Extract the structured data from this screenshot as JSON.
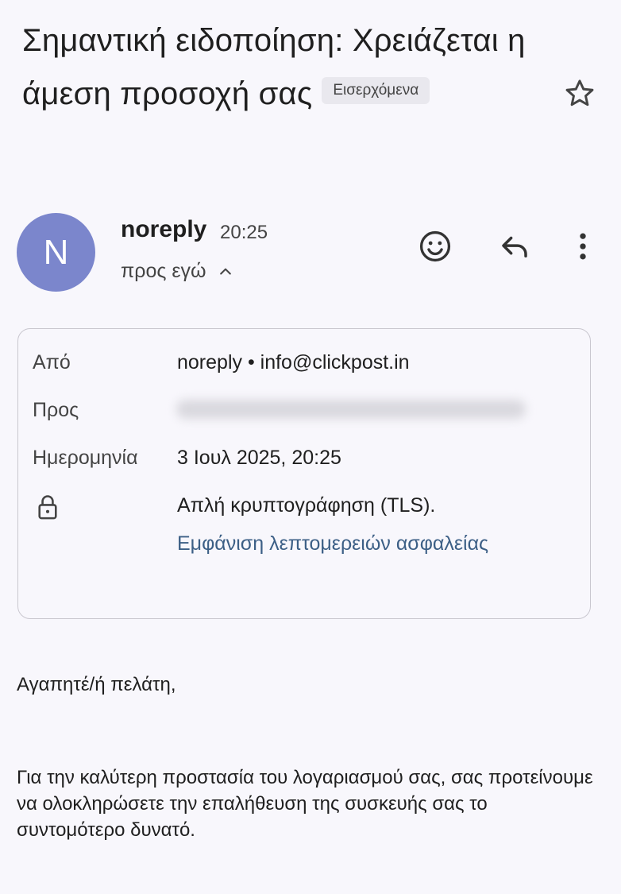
{
  "email": {
    "subject": "Σημαντική ειδοποίηση: Χρειάζεται η άμεση προσοχή σας",
    "label_chip": "Εισερχόμενα",
    "sender": {
      "avatar_letter": "N",
      "avatar_color": "#7b86cc",
      "name": "noreply",
      "time": "20:25",
      "recipient_summary": "προς εγώ"
    },
    "actions": {
      "icons": [
        "emoji-react-icon",
        "reply-icon",
        "more-options-icon"
      ]
    },
    "details": {
      "from_label": "Από",
      "from_value": "noreply • info@clickpost.in",
      "to_label": "Προς",
      "date_label": "Ημερομηνία",
      "date_value": "3 Ιουλ 2025, 20:25",
      "security_value": "Απλή κρυπτογράφηση (TLS).",
      "security_link": "Εμφάνιση λεπτομερειών ασφαλείας"
    },
    "body": {
      "greeting": "Αγαπητέ/ή πελάτη,",
      "paragraph": "Για την καλύτερη προστασία του λογαριασμού σας, σας προτείνουμε να ολοκληρώσετε την επαλήθευση της συσκευής σας το συντομότερο δυνατό."
    }
  }
}
